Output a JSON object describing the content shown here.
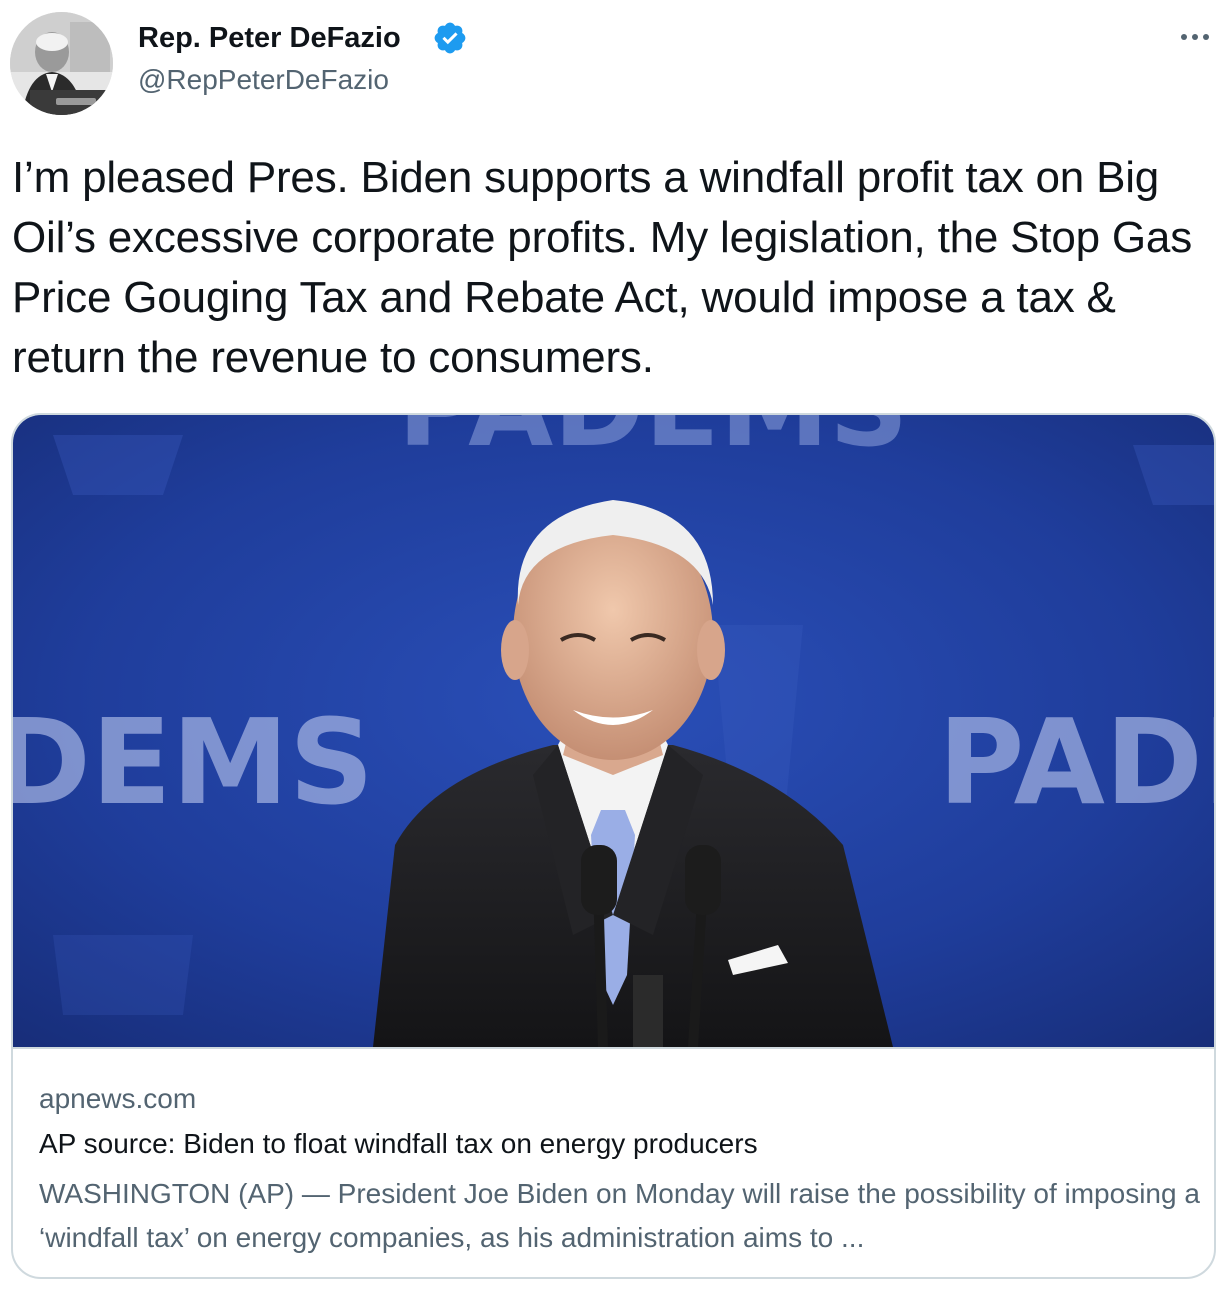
{
  "author": {
    "name": "Rep. Peter DeFazio",
    "handle": "@RepPeterDeFazio",
    "verified": true,
    "avatar_icon": "profile-photo"
  },
  "menu_icon": "more-options-icon",
  "tweet": {
    "text": "I’m pleased Pres. Biden supports a windfall profit tax on Big Oil’s excessive corporate profits. My legislation, the Stop Gas Price Gouging Tax and Rebate Act, would impose a tax & return the revenue to consumers."
  },
  "card": {
    "image_backdrop_text": {
      "left": "DEMS",
      "right": "PADI",
      "top": "PADEMS"
    },
    "domain": "apnews.com",
    "title": "AP source: Biden to float windfall tax on energy producers",
    "description": "WASHINGTON (AP) — President Joe Biden on Monday will raise the possibility of imposing a ‘windfall tax’ on energy companies, as his administration aims to ..."
  },
  "colors": {
    "text_primary": "#0f1419",
    "text_secondary": "#536471",
    "verified_badge": "#1d9bf0",
    "card_border": "#cfd9de",
    "backdrop_blue": "#1f3d9b"
  }
}
